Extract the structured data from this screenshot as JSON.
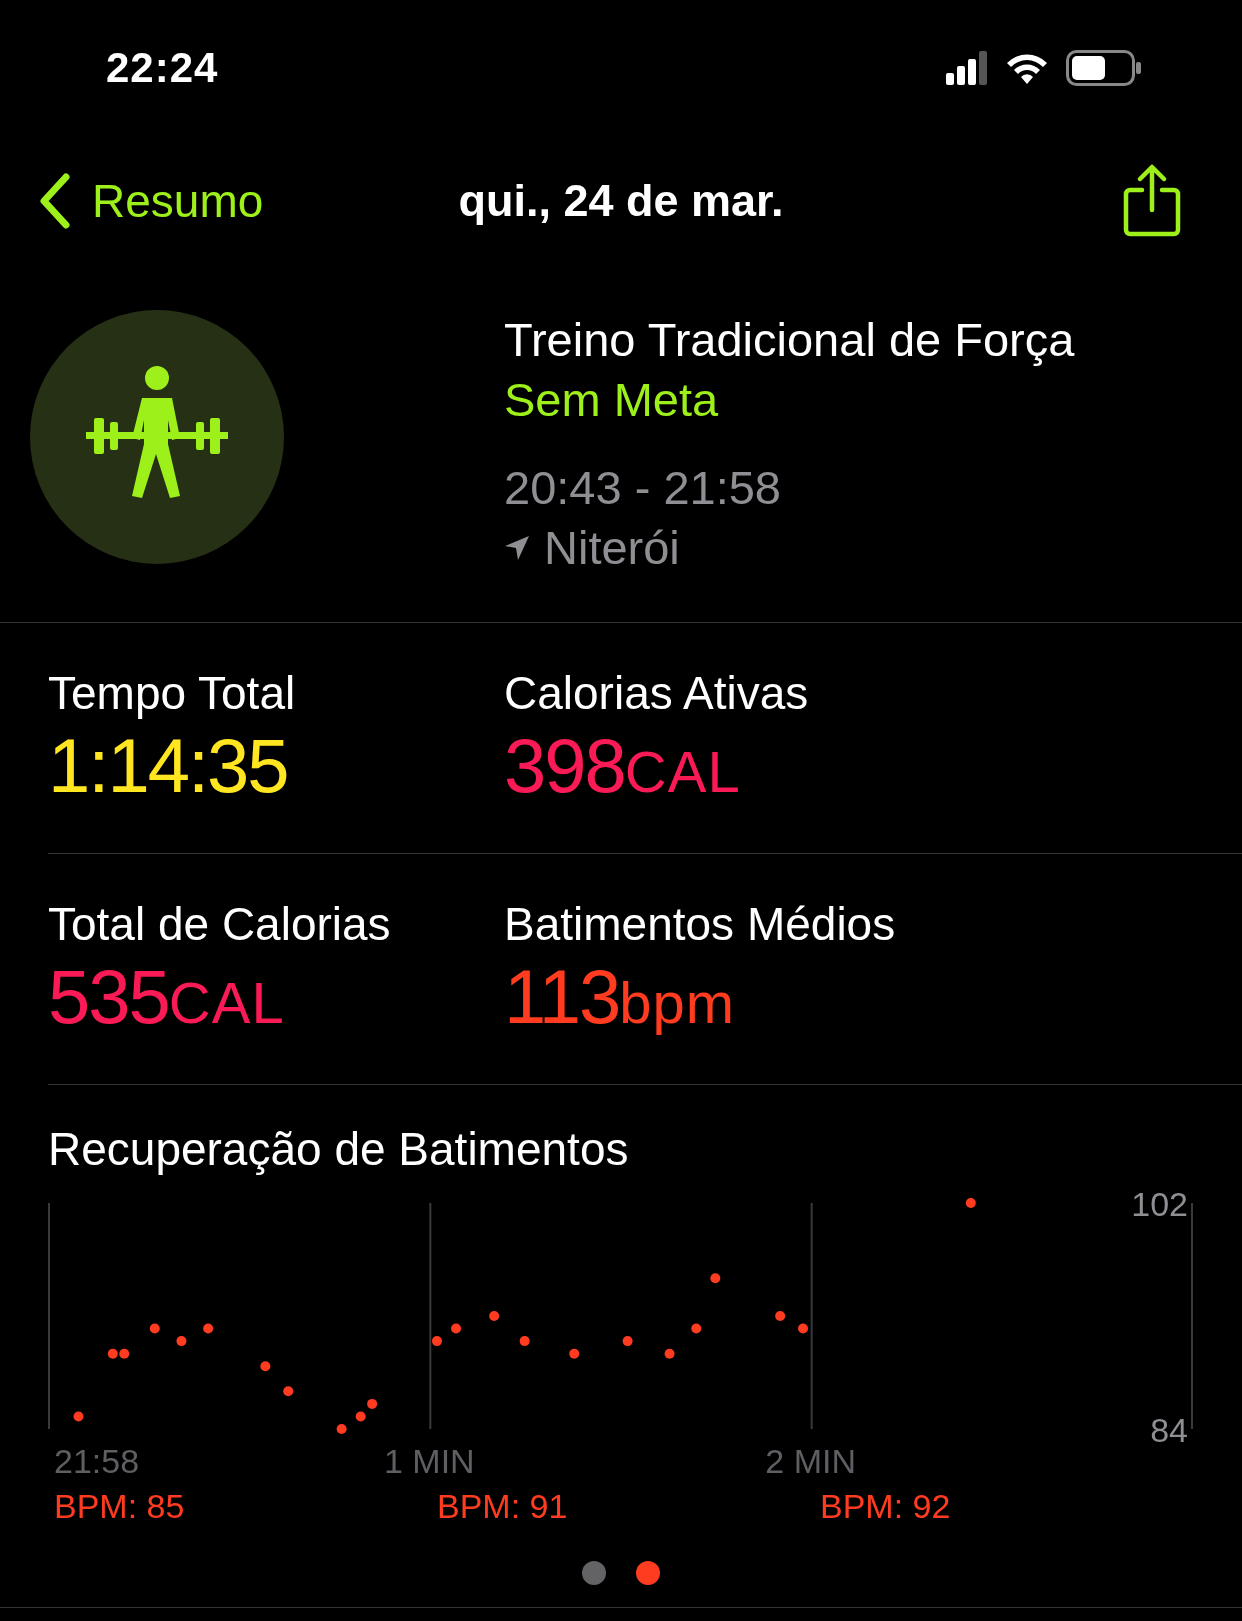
{
  "status_bar": {
    "time": "22:24"
  },
  "nav": {
    "back_label": "Resumo",
    "title": "qui., 24 de mar."
  },
  "workout": {
    "name": "Treino Tradicional de Força",
    "goal": "Sem Meta",
    "time_range": "20:43 - 21:58",
    "location": "Niterói"
  },
  "stats": [
    {
      "label": "Tempo Total",
      "value": "1:14:35",
      "color": "#ffe620"
    },
    {
      "label": "Calorias Ativas",
      "value": "398",
      "unit": "CAL",
      "color": "#fa1a55"
    },
    {
      "label": "Total de Calorias",
      "value": "535",
      "unit": "CAL",
      "color": "#fa1a55"
    },
    {
      "label": "Batimentos Médios",
      "value": "113",
      "unit": "bpm",
      "color": "#ff3b20"
    }
  ],
  "heart_recovery": {
    "title": "Recuperação de Batimentos",
    "start_label": "21:58",
    "chart_data": {
      "type": "scatter",
      "xlim": [
        0,
        3
      ],
      "ylim": [
        84,
        102
      ],
      "yticks": [
        84,
        102
      ],
      "xticks": [
        {
          "value": 1,
          "label": "1 MIN"
        },
        {
          "value": 2,
          "label": "2 MIN"
        }
      ],
      "series": [
        {
          "color": "#ff3b20",
          "x": [
            0.08,
            0.17,
            0.2,
            0.28,
            0.35,
            0.42,
            0.57,
            0.63,
            0.77,
            0.82,
            0.85,
            1.02,
            1.07,
            1.17,
            1.25,
            1.38,
            1.52,
            1.63,
            1.7,
            1.75,
            1.92,
            1.98,
            2.42
          ],
          "values": [
            85,
            90,
            90,
            92,
            91,
            92,
            89,
            87,
            84,
            85,
            86,
            91,
            92,
            93,
            91,
            90,
            91,
            90,
            92,
            96,
            93,
            92,
            102
          ]
        }
      ]
    },
    "bpm_labels": [
      "BPM: 85",
      "BPM: 91",
      "BPM: 92"
    ]
  },
  "pages": [
    {
      "selected": false
    },
    {
      "selected": true
    }
  ]
}
